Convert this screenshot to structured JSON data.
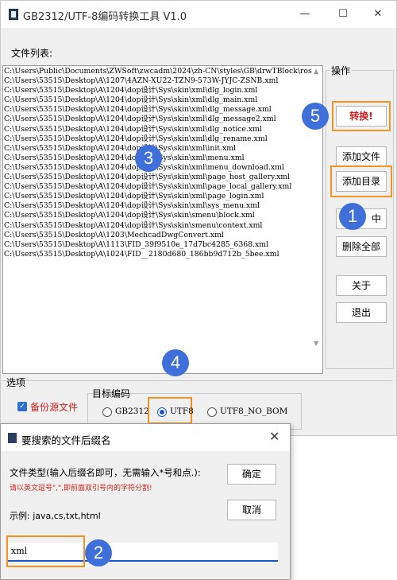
{
  "window": {
    "title": "GB2312/UTF-8编码转换工具 V1.0",
    "minimize": "—",
    "maximize": "☐",
    "close": "✕"
  },
  "file_list": {
    "label": "文件列表:",
    "rows": [
      "C:\\Users\\Public\\Documents\\ZWSoft\\zwcadm\\2024\\zh-CN\\styles\\GB\\drwTBlock\\ross",
      "C:\\Users\\53515\\Desktop\\A\\1207\\4AZN-XU22-TZN9-573W-JYJC-ZSNB.xml",
      "C:\\Users\\53515\\Desktop\\A\\1204\\dop设计\\Sys\\skin\\xml\\dlg_login.xml",
      "C:\\Users\\53515\\Desktop\\A\\1204\\dop设计\\Sys\\skin\\xml\\dlg_main.xml",
      "C:\\Users\\53515\\Desktop\\A\\1204\\dop设计\\Sys\\skin\\xml\\dlg_message.xml",
      "C:\\Users\\53515\\Desktop\\A\\1204\\dop设计\\Sys\\skin\\xml\\dlg_message2.xml",
      "C:\\Users\\53515\\Desktop\\A\\1204\\dop设计\\Sys\\skin\\xml\\dlg_notice.xml",
      "C:\\Users\\53515\\Desktop\\A\\1204\\dop设计\\Sys\\skin\\xml\\dlg_rename.xml",
      "C:\\Users\\53515\\Desktop\\A\\1204\\dop设计\\Sys\\skin\\xml\\init.xml",
      "C:\\Users\\53515\\Desktop\\A\\1204\\dop设计\\Sys\\skin\\xml\\menu.xml",
      "C:\\Users\\53515\\Desktop\\A\\1204\\dop设计\\Sys\\skin\\xml\\menu_download.xml",
      "C:\\Users\\53515\\Desktop\\A\\1204\\dop设计\\Sys\\skin\\xml\\page_host_gallery.xml",
      "C:\\Users\\53515\\Desktop\\A\\1204\\dop设计\\Sys\\skin\\xml\\page_local_gallery.xml",
      "C:\\Users\\53515\\Desktop\\A\\1204\\dop设计\\Sys\\skin\\xml\\page_login.xml",
      "C:\\Users\\53515\\Desktop\\A\\1204\\dop设计\\Sys\\skin\\xml\\sys_menu.xml",
      "C:\\Users\\53515\\Desktop\\A\\1204\\dop设计\\Sys\\skin\\smenu\\block.xml",
      "C:\\Users\\53515\\Desktop\\A\\1204\\dop设计\\Sys\\skin\\smenu\\context.xml",
      "C:\\Users\\53515\\Desktop\\A\\1203\\MechcadDwgConvert.xml",
      "C:\\Users\\53515\\Desktop\\A\\1113\\FID_39f9510e_17d7bc4285_6368.xml",
      "C:\\Users\\53515\\Desktop\\A\\1024\\FID__2180d680_186bb9d712b_5bee.xml"
    ]
  },
  "ops": {
    "legend": "操作",
    "convert": "转换!",
    "add_file": "添加文件",
    "add_dir": "添加目录",
    "remove_selected_suffix": "中",
    "remove_all": "删除全部",
    "about": "关于",
    "exit": "退出"
  },
  "options": {
    "legend": "选项",
    "backup_label": "备份源文件",
    "backup_checked": true,
    "encoding_legend": "目标编码",
    "encodings": [
      "GB2312",
      "UTF8",
      "UTF8_NO_BOM"
    ],
    "selected_encoding": "UTF8"
  },
  "dialog": {
    "title": "要搜索的文件后缀名",
    "prompt": "文件类型(输入后缀名即可，无需输入*号和点.):",
    "warning": "请以英文逗号\",\",即前面双引号内的字符分割!",
    "example": "示例: java,cs,txt,html",
    "ok": "确定",
    "cancel": "取消",
    "input_value": "xml"
  },
  "badges": [
    "1",
    "2",
    "3",
    "4",
    "5"
  ],
  "colors": {
    "badge_blue": "#3f6fd8",
    "highlight_orange": "#f29322",
    "warning_red": "#d12020"
  }
}
